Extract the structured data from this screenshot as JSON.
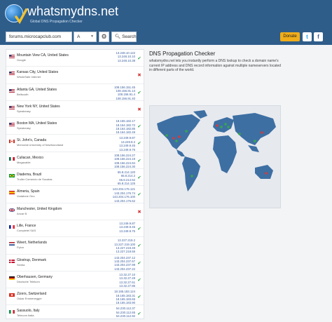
{
  "header": {
    "title": "whatsmydns.net",
    "subtitle": "Global DNS Propagation Checker"
  },
  "toolbar": {
    "domain_value": "forums.microcapclub.com",
    "record_type": "A",
    "search_label": "Search",
    "donate_label": "Donate",
    "icons": {
      "settings": "gear-icon",
      "search": "search-icon",
      "twitter": "twitter-icon",
      "facebook": "facebook-icon"
    }
  },
  "results": [
    {
      "location": "Mountain View CA, United States",
      "isp": "Google",
      "ips": [
        "13.248.10.122",
        "13.248.10.10",
        "13.248.10.38"
      ],
      "status": "ok",
      "flag": "us"
    },
    {
      "location": "Kansas City, United States",
      "isp": "WholeSale Internet",
      "ips": [],
      "status": "fail",
      "flag": "us"
    },
    {
      "location": "Atlanta GA, United States",
      "isp": "Bellsouth",
      "ips": [
        "108.156.151.45",
        "108.156.91.13",
        "108.156.91.4",
        "108.156.91.40"
      ],
      "status": "ok",
      "flag": "us"
    },
    {
      "location": "New York NY, United States",
      "isp": "Speakeasy",
      "ips": [],
      "status": "fail",
      "flag": "us"
    },
    {
      "location": "Boston MA, United States",
      "isp": "Speakeasy",
      "ips": [
        "18.165.182.17",
        "18.164.182.72",
        "18.164.182.85",
        "18.164.182.49"
      ],
      "status": "ok",
      "flag": "us"
    },
    {
      "location": "St. John's, Canada",
      "isp": "Memorial University of Newfoundland",
      "ips": [
        "13.249.9.87",
        "13.249.9.2",
        "13.249.9.45",
        "13.249.9.75"
      ],
      "status": "ok",
      "flag": "ca"
    },
    {
      "location": "Culiacan, Mexico",
      "isp": "Megacable",
      "ips": [
        "108.156.224.27",
        "108.156.224.19",
        "108.156.224.84",
        "108.156.224.30"
      ],
      "status": "ok",
      "flag": "mx"
    },
    {
      "location": "Diadema, Brazil",
      "isp": "Truller Comercio de Sucatas",
      "ips": [
        "65.8.214.120",
        "65.8.214.2",
        "65.8.214.52",
        "65.8.214.125"
      ],
      "status": "ok",
      "flag": "br"
    },
    {
      "location": "Almeria, Spain",
      "isp": "Vodafone Ono",
      "ips": [
        "143.204.176.121",
        "143.204.176.74",
        "143.204.176.100",
        "143.204.176.62"
      ],
      "status": "ok",
      "flag": "es"
    },
    {
      "location": "Manchester, United Kingdom",
      "isp": "Ancar B",
      "ips": [],
      "status": "fail",
      "flag": "gb"
    },
    {
      "location": "Lille, France",
      "isp": "Completel SAS",
      "ips": [
        "13.249.9.87",
        "13.249.9.45",
        "13.249.9.75"
      ],
      "status": "ok",
      "flag": "fr"
    },
    {
      "location": "Weert, Netherlands",
      "isp": "Pylon",
      "ips": [
        "13.227.219.2",
        "13.227.219.100",
        "13.227.219.49",
        "13.227.219.55"
      ],
      "status": "ok",
      "flag": "nl"
    },
    {
      "location": "Glostrup, Denmark",
      "isp": "Sentia",
      "ips": [
        "143.204.237.12",
        "143.204.237.67",
        "143.204.237.99",
        "143.204.237.22"
      ],
      "status": "ok",
      "flag": "dk"
    },
    {
      "location": "Oberhausen, Germany",
      "isp": "Deutsche Telekom",
      "ips": [
        "13.32.27.10",
        "13.32.27.49",
        "13.32.27.61",
        "13.32.27.85"
      ],
      "status": "ok",
      "flag": "de"
    },
    {
      "location": "Zizers, Switzerland",
      "isp": "Oskar Emmenegger",
      "ips": [
        "18.165.183.124",
        "18.165.183.31",
        "18.165.183.65",
        "18.165.183.90"
      ],
      "status": "ok",
      "flag": "ch"
    },
    {
      "location": "Sassuolo, Italy",
      "isp": "Telecom Italia",
      "ips": [
        "54.230.112.37",
        "54.230.112.65",
        "54.230.112.92",
        "54.230.112.15"
      ],
      "status": "ok",
      "flag": "it"
    }
  ],
  "about": {
    "title": "DNS Propagation Checker",
    "text": "whatsmydns.net lets you instantly perform a DNS lookup to check a domain name's current IP address and DNS record information against multiple nameservers located in different parts of the world."
  },
  "colors": {
    "header": "#2f5d8a",
    "ok": "#36a64f",
    "fail": "#d43b3b",
    "donate": "#f0ad1a",
    "map_land": "#3d6fa3"
  }
}
